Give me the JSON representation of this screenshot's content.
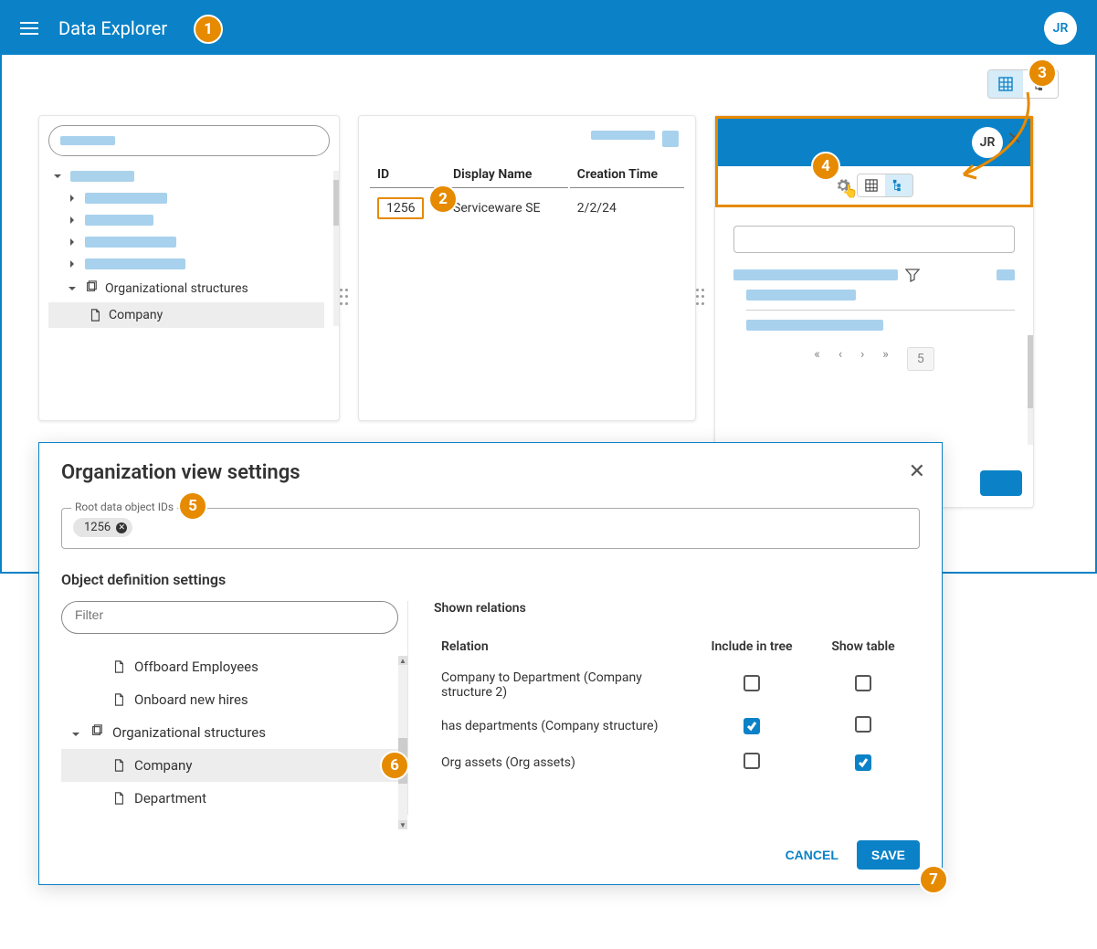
{
  "header": {
    "app_title": "Data Explorer",
    "avatar_initials": "JR"
  },
  "view_toggle": {
    "table_icon": "table",
    "tree_icon": "tree"
  },
  "left_panel": {
    "tree": {
      "org_structures_label": "Organizational structures",
      "company_label": "Company"
    }
  },
  "mid_panel": {
    "columns": {
      "id": "ID",
      "display_name": "Display Name",
      "creation_time": "Creation Time"
    },
    "row": {
      "id": "1256",
      "display_name": "Serviceware SE",
      "creation_time": "2/2/24"
    }
  },
  "right_panel": {
    "avatar_initials": "JR",
    "pager_page": "5"
  },
  "dialog": {
    "title": "Organization view settings",
    "root_ids_legend": "Root data object IDs",
    "root_id_chip": "1256",
    "section_heading": "Object definition settings",
    "filter_placeholder": "Filter",
    "def_tree": {
      "offboard": "Offboard Employees",
      "onboard": "Onboard new hires",
      "org_structures": "Organizational structures",
      "company": "Company",
      "department": "Department"
    },
    "relations": {
      "heading": "Shown relations",
      "col_relation": "Relation",
      "col_include": "Include in tree",
      "col_show_table": "Show table",
      "rows": [
        {
          "label": "Company to Department (Company structure 2)",
          "include": false,
          "show_table": false
        },
        {
          "label": "has departments (Company structure)",
          "include": true,
          "show_table": false
        },
        {
          "label": "Org assets (Org assets)",
          "include": false,
          "show_table": true
        }
      ]
    },
    "cancel_label": "CANCEL",
    "save_label": "SAVE"
  },
  "callouts": {
    "c1": "1",
    "c2": "2",
    "c3": "3",
    "c4": "4",
    "c5": "5",
    "c6": "6",
    "c7": "7"
  }
}
